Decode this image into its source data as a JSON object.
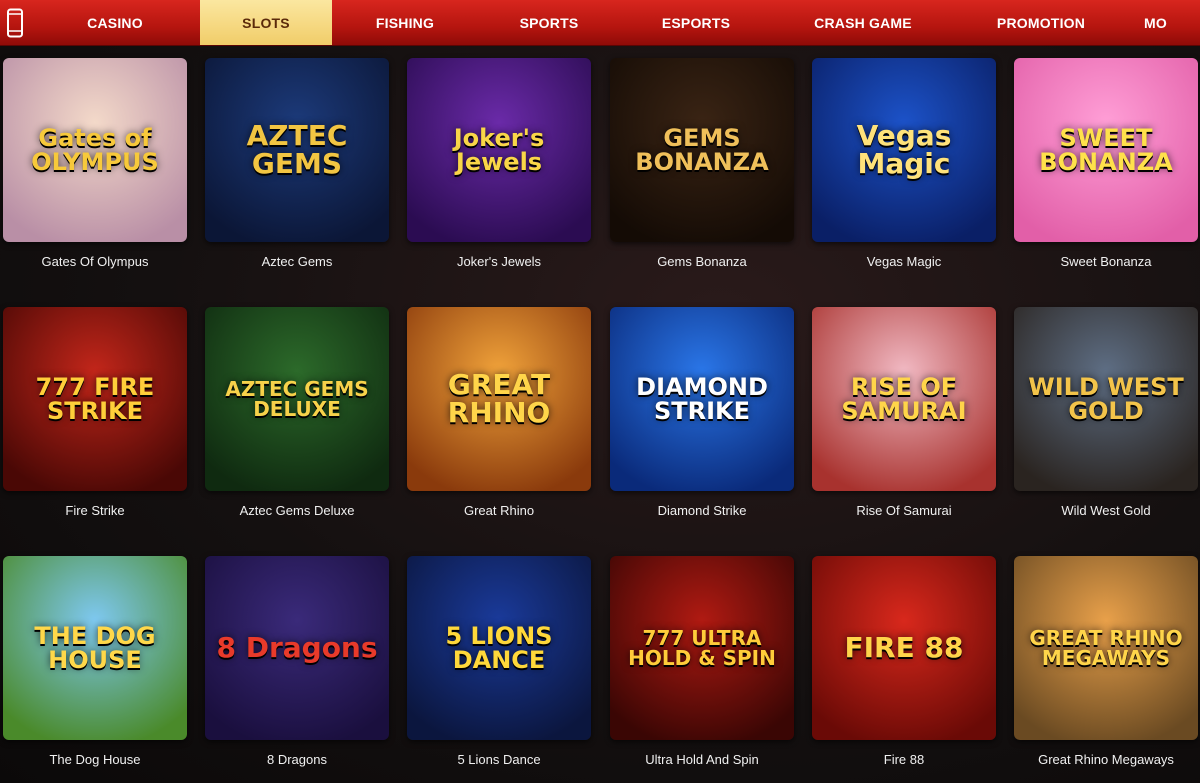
{
  "nav": {
    "items": [
      {
        "label": "CASINO"
      },
      {
        "label": "SLOTS"
      },
      {
        "label": "FISHING"
      },
      {
        "label": "SPORTS"
      },
      {
        "label": "ESPORTS"
      },
      {
        "label": "CRASH GAME"
      },
      {
        "label": "PROMOTION"
      },
      {
        "label": "MO"
      }
    ],
    "active_index": 1
  },
  "games": [
    {
      "title": "Gates Of Olympus",
      "logo": "Gates of OLYMPUS",
      "bg": [
        "#f3d9c9",
        "#b98fa6"
      ],
      "fg": "#f7c93b"
    },
    {
      "title": "Aztec Gems",
      "logo": "AZTEC GEMS",
      "bg": [
        "#1c3a7a",
        "#0b1636"
      ],
      "fg": "#f2c542"
    },
    {
      "title": "Joker's Jewels",
      "logo": "Joker's Jewels",
      "bg": [
        "#6a2aa8",
        "#2b0c52"
      ],
      "fg": "#f9d648"
    },
    {
      "title": "Gems Bonanza",
      "logo": "GEMS BONANZA",
      "bg": [
        "#3a2414",
        "#140b05"
      ],
      "fg": "#f0c05a"
    },
    {
      "title": "Vegas Magic",
      "logo": "Vegas Magic",
      "bg": [
        "#1c52c8",
        "#0a1f66"
      ],
      "fg": "#ffe27a"
    },
    {
      "title": "Sweet Bonanza",
      "logo": "SWEET BONANZA",
      "bg": [
        "#ff9ed6",
        "#e25fa8"
      ],
      "fg": "#ffe14b"
    },
    {
      "title": "Fire Strike",
      "logo": "777 FIRE STRIKE",
      "bg": [
        "#c2261a",
        "#4a0805"
      ],
      "fg": "#ffcf3a"
    },
    {
      "title": "Aztec Gems Deluxe",
      "logo": "AZTEC GEMS DELUXE",
      "bg": [
        "#2c6a2a",
        "#0f2a10"
      ],
      "fg": "#f7d24a"
    },
    {
      "title": "Great Rhino",
      "logo": "GREAT RHINO",
      "bg": [
        "#f0a23a",
        "#8a3a0c"
      ],
      "fg": "#ffd54a"
    },
    {
      "title": "Diamond Strike",
      "logo": "DIAMOND STRIKE",
      "bg": [
        "#2a76e8",
        "#0a2a7a"
      ],
      "fg": "#ffffff"
    },
    {
      "title": "Rise Of Samurai",
      "logo": "RISE OF SAMURAI",
      "bg": [
        "#f1b9c3",
        "#a8322e"
      ],
      "fg": "#ffd54a"
    },
    {
      "title": "Wild West Gold",
      "logo": "WILD WEST GOLD",
      "bg": [
        "#5e6e84",
        "#2a2420"
      ],
      "fg": "#f3c44a"
    },
    {
      "title": "The Dog House",
      "logo": "THE DOG HOUSE",
      "bg": [
        "#7ec8f0",
        "#4a8a2a"
      ],
      "fg": "#ffd84a"
    },
    {
      "title": "8 Dragons",
      "logo": "8 Dragons",
      "bg": [
        "#3a2a7a",
        "#1a0f3e"
      ],
      "fg": "#e83a2a"
    },
    {
      "title": "5 Lions Dance",
      "logo": "5 LIONS DANCE",
      "bg": [
        "#1a3a9a",
        "#0b163e"
      ],
      "fg": "#ffd83a"
    },
    {
      "title": "Ultra Hold And Spin",
      "logo": "777 ULTRA HOLD & SPIN",
      "bg": [
        "#b01a12",
        "#3a0604"
      ],
      "fg": "#ffcc3a"
    },
    {
      "title": "Fire 88",
      "logo": "FIRE 88",
      "bg": [
        "#d8281c",
        "#6a0a06"
      ],
      "fg": "#ffd44a"
    },
    {
      "title": "Great Rhino Megaways",
      "logo": "GREAT RHINO MEGAWAYS",
      "bg": [
        "#e8a04a",
        "#6a4a22"
      ],
      "fg": "#ffd54a"
    }
  ]
}
